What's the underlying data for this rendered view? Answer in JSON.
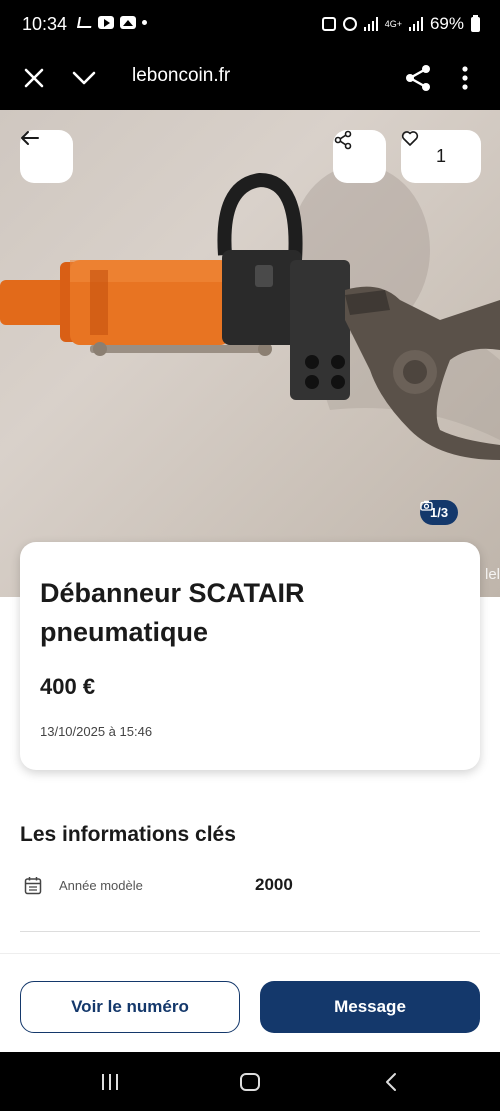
{
  "status_bar": {
    "time": "10:34",
    "battery": "69%",
    "network": "4G+"
  },
  "browser": {
    "url": "leboncoin.fr",
    "icons": [
      "close-icon",
      "chevron-down-icon",
      "share-icon",
      "more-vertical-icon"
    ]
  },
  "gallery": {
    "favorite_count": "1",
    "counter": "1/3",
    "edge_text": "lel"
  },
  "listing": {
    "title": "Débanneur SCATAIR pneumatique",
    "price": "400 €",
    "date": "13/10/2025 à 15:46"
  },
  "key_info": {
    "section_title": "Les informations clés",
    "rows": [
      {
        "label": "Année modèle",
        "value": "2000",
        "icon": "calendar-icon"
      }
    ]
  },
  "actions": {
    "phone_label": "Voir le numéro",
    "message_label": "Message"
  },
  "colors": {
    "primary": "#14386b",
    "background": "#ffffff",
    "text": "#1a1a1a"
  }
}
